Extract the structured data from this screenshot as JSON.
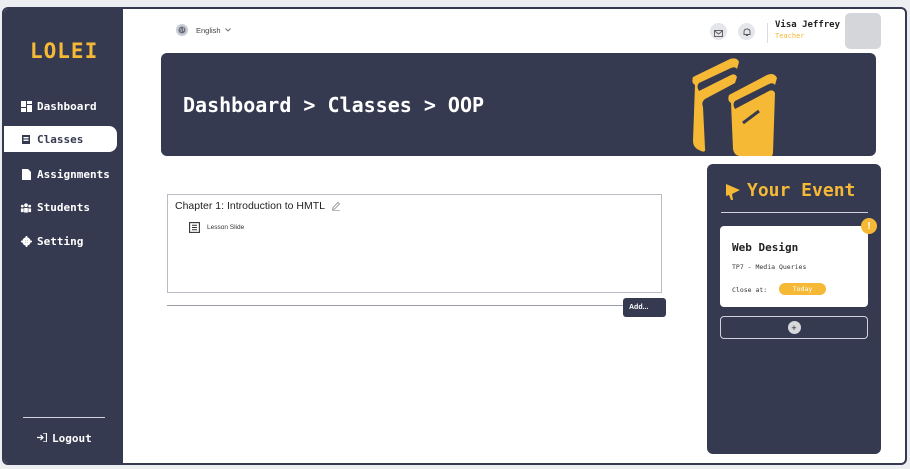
{
  "brand": {
    "logo": "LOLEI"
  },
  "sidebar": {
    "items": [
      {
        "label": "Dashboard",
        "icon": "dashboard-icon"
      },
      {
        "label": "Classes",
        "icon": "book-icon"
      },
      {
        "label": "Assignments",
        "icon": "file-icon"
      },
      {
        "label": "Students",
        "icon": "users-icon"
      },
      {
        "label": "Setting",
        "icon": "gear-icon"
      }
    ],
    "active": "Classes",
    "logout_label": "Logout"
  },
  "topbar": {
    "language": "English",
    "user": {
      "name": "Visa Jeffrey",
      "role": "Teacher"
    }
  },
  "banner": {
    "breadcrumb": "Dashboard > Classes > OOP"
  },
  "chapter": {
    "title": "Chapter 1: Introduction to HMTL",
    "lessons": [
      {
        "label": "Lesson Slide"
      }
    ],
    "add_label": "Add..."
  },
  "events": {
    "heading": "Your Event",
    "items": [
      {
        "title": "Web Design",
        "subtitle": "TP7 - Media Queries",
        "close_label": "Close at:",
        "close_value": "Today",
        "badge": "!"
      }
    ],
    "add_symbol": "+"
  },
  "colors": {
    "navy": "#363a50",
    "accent": "#f5b935",
    "background": "#ffffff"
  }
}
